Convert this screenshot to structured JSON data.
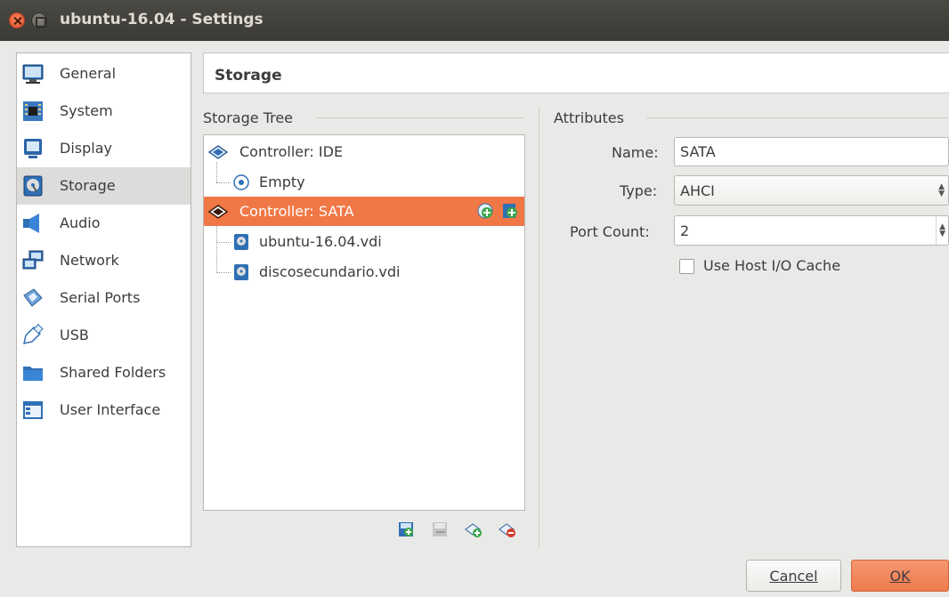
{
  "window": {
    "title": "ubuntu-16.04 - Settings"
  },
  "sidebar": {
    "items": [
      {
        "label": "General",
        "icon": "monitor-icon"
      },
      {
        "label": "System",
        "icon": "chip-icon"
      },
      {
        "label": "Display",
        "icon": "display-icon"
      },
      {
        "label": "Storage",
        "icon": "storage-icon",
        "active": true
      },
      {
        "label": "Audio",
        "icon": "speaker-icon"
      },
      {
        "label": "Network",
        "icon": "network-icon"
      },
      {
        "label": "Serial Ports",
        "icon": "serial-port-icon"
      },
      {
        "label": "USB",
        "icon": "usb-icon"
      },
      {
        "label": "Shared Folders",
        "icon": "folder-icon"
      },
      {
        "label": "User Interface",
        "icon": "window-icon"
      }
    ]
  },
  "header": {
    "title": "Storage"
  },
  "storage_tree": {
    "legend": "Storage Tree",
    "nodes": [
      {
        "label": "Controller: IDE",
        "icon": "ide-controller-icon"
      },
      {
        "label": "Empty",
        "icon": "optical-disc-icon"
      },
      {
        "label": "Controller: SATA",
        "icon": "sata-controller-icon",
        "selected": true
      },
      {
        "label": "ubuntu-16.04.vdi",
        "icon": "hard-disk-icon"
      },
      {
        "label": "discosecundario.vdi",
        "icon": "hard-disk-icon"
      }
    ]
  },
  "attributes": {
    "legend": "Attributes",
    "name_label": "Name:",
    "name_value": "SATA",
    "type_label": "Type:",
    "type_value": "AHCI",
    "port_count_label": "Port Count:",
    "port_count_value": "2",
    "host_io_cache_label": "Use Host I/O Cache",
    "host_io_cache_checked": false
  },
  "buttons": {
    "cancel": "Cancel",
    "ok": "OK"
  },
  "colors": {
    "accent": "#f07746",
    "titlebar": "#3e3d39"
  }
}
